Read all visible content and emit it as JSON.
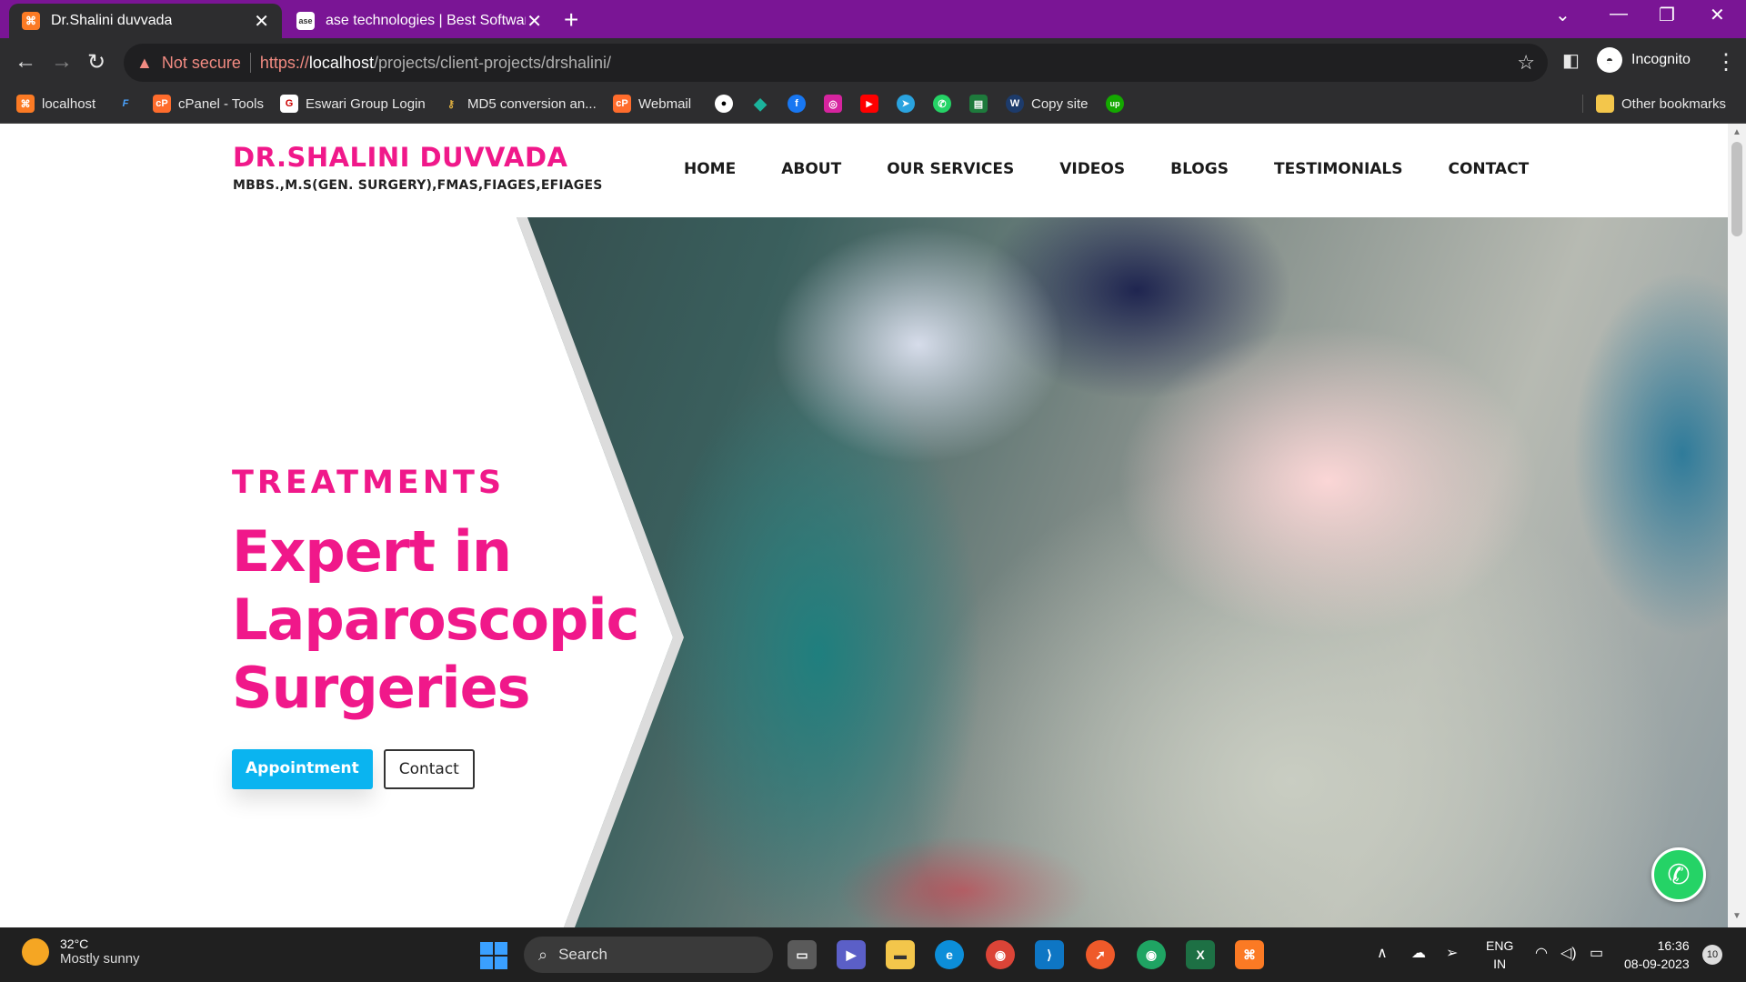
{
  "browser": {
    "tabs": [
      {
        "title": "Dr.Shalini duvvada",
        "active": true
      },
      {
        "title": "ase technologies | Best Software",
        "active": false
      }
    ],
    "new_tab": "+",
    "security_label": "Not secure",
    "url": {
      "scheme": "https://",
      "host": "localhost",
      "path": "/projects/client-projects/drshalini/"
    },
    "profile_label": "Incognito",
    "bookmarks": [
      {
        "label": "localhost",
        "icon": "xampp-icon"
      },
      {
        "label": "",
        "icon": "f-icon"
      },
      {
        "label": "cPanel - Tools",
        "icon": "cpanel-icon"
      },
      {
        "label": "Eswari Group Login",
        "icon": "eswari-icon"
      },
      {
        "label": "MD5 conversion an...",
        "icon": "key-icon"
      },
      {
        "label": "Webmail",
        "icon": "cpanel-icon"
      },
      {
        "label": "",
        "icon": "github-icon"
      },
      {
        "label": "",
        "icon": "diamond-icon"
      },
      {
        "label": "",
        "icon": "facebook-icon"
      },
      {
        "label": "",
        "icon": "instagram-icon"
      },
      {
        "label": "",
        "icon": "youtube-icon"
      },
      {
        "label": "",
        "icon": "telegram-icon"
      },
      {
        "label": "",
        "icon": "whatsapp-icon"
      },
      {
        "label": "",
        "icon": "sheet-icon"
      },
      {
        "label": "Copy site",
        "icon": "w-icon"
      },
      {
        "label": "",
        "icon": "upwork-icon"
      }
    ],
    "other_bookmarks": "Other bookmarks"
  },
  "site": {
    "brand_name": "DR.SHALINI DUVVADA",
    "brand_sub": "MBBS.,M.S(GEN. SURGERY),FMAS,FIAGES,EFIAGES",
    "nav": [
      "HOME",
      "ABOUT",
      "OUR SERVICES",
      "VIDEOS",
      "BLOGS",
      "TESTIMONIALS",
      "CONTACT"
    ],
    "hero": {
      "eyebrow": "TREATMENTS",
      "headline_lines": [
        "Expert in",
        "Laparoscopic",
        "Surgeries"
      ],
      "primary_button": "Appointment",
      "secondary_button": "Contact"
    }
  },
  "taskbar": {
    "weather_temp": "32°C",
    "weather_desc": "Mostly sunny",
    "search_label": "Search",
    "language": [
      "ENG",
      "IN"
    ],
    "time": "16:36",
    "date": "08-09-2023",
    "notifications": "10"
  },
  "colors": {
    "brand_pink": "#f0188a",
    "accent_blue": "#0ab4f0",
    "tab_strip": "#7a1595"
  }
}
